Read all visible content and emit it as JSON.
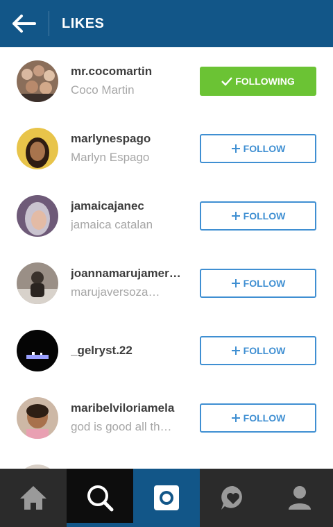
{
  "header": {
    "title": "LIKES"
  },
  "colors": {
    "brand": "#125688",
    "follow_blue": "#3f8fd2",
    "following_green": "#6bc334"
  },
  "users": [
    {
      "username": "mr.cocomartin",
      "fullname": "Coco Martin",
      "button": "FOLLOWING",
      "state": "following"
    },
    {
      "username": "marlynespago",
      "fullname": "Marlyn Espago",
      "button": "FOLLOW",
      "state": "follow"
    },
    {
      "username": "jamaicajanec",
      "fullname": "jamaica catalan",
      "button": "FOLLOW",
      "state": "follow"
    },
    {
      "username": "joannamarujamer…",
      "fullname": "marujaversoza…",
      "button": "FOLLOW",
      "state": "follow"
    },
    {
      "username": "_gelryst.22",
      "fullname": "",
      "button": "FOLLOW",
      "state": "follow"
    },
    {
      "username": "maribelviloriamela",
      "fullname": "god is good all th…",
      "button": "FOLLOW",
      "state": "follow"
    }
  ],
  "tabs": [
    {
      "icon": "home-icon"
    },
    {
      "icon": "search-icon"
    },
    {
      "icon": "camera-icon"
    },
    {
      "icon": "activity-heart-icon"
    },
    {
      "icon": "profile-icon"
    }
  ]
}
